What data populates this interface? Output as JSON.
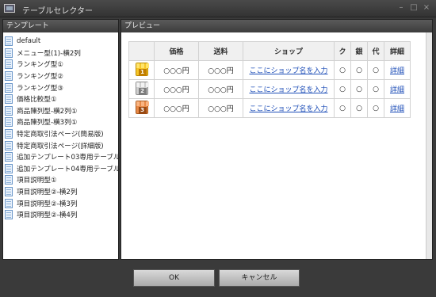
{
  "window": {
    "title": "テーブルセレクター",
    "minimize_label": "–",
    "maximize_label": "□",
    "close_label": "×"
  },
  "left_panel": {
    "header": "テンプレート",
    "items": [
      "default",
      "メニュー型(1)-横2列",
      "ランキング型①",
      "ランキング型②",
      "ランキング型③",
      "価格比較型①",
      "商品陳列型-横2列①",
      "商品陳列型-横3列①",
      "特定商取引法ページ(簡易版)",
      "特定商取引法ページ(詳細版)",
      "追加テンプレート03専用テーブル",
      "追加テンプレート04専用テーブル",
      "項目説明型①",
      "項目説明型②-横2列",
      "項目説明型②-横3列",
      "項目説明型②-横4列"
    ]
  },
  "right_panel": {
    "header": "プレビュー",
    "columns": [
      "",
      "価格",
      "送料",
      "ショップ",
      "ク",
      "銀",
      "代",
      "詳細"
    ],
    "rows": [
      {
        "rank": "1",
        "medal": "gold",
        "price": "○○○円",
        "ship": "○○○円",
        "shop": "ここにショップ名を入力",
        "c1": "○",
        "c2": "○",
        "c3": "○",
        "detail": "詳細"
      },
      {
        "rank": "2",
        "medal": "silver",
        "price": "○○○円",
        "ship": "○○○円",
        "shop": "ここにショップ名を入力",
        "c1": "○",
        "c2": "○",
        "c3": "○",
        "detail": "詳細"
      },
      {
        "rank": "3",
        "medal": "bronze",
        "price": "○○○円",
        "ship": "○○○円",
        "shop": "ここにショップ名を入力",
        "c1": "○",
        "c2": "○",
        "c3": "○",
        "detail": "詳細"
      }
    ]
  },
  "buttons": {
    "ok": "OK",
    "cancel": "キャンセル"
  }
}
